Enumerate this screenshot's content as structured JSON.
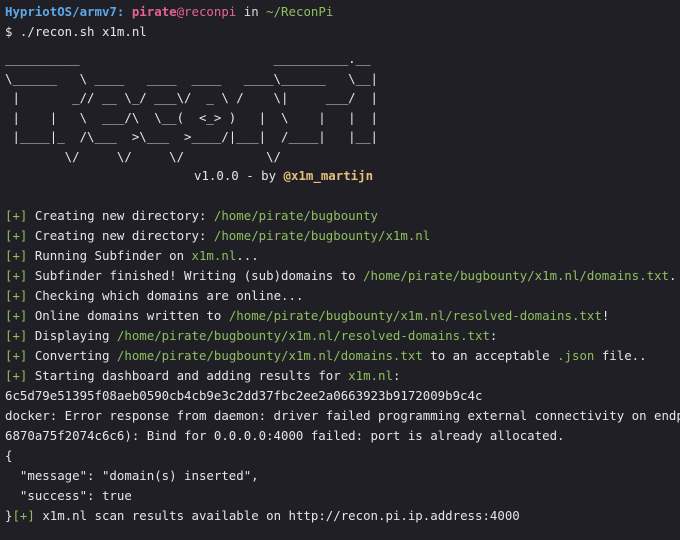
{
  "prompt": {
    "user": "HypriotOS/armv7:",
    "name": "pirate",
    "host": "@reconpi",
    "in": "in",
    "path": "~/ReconPi"
  },
  "command": "$ ./recon.sh x1m.nl",
  "banner": [
    "__________                          __________.__",
    "\\______   \\ ____   ____  ____   ____\\______   \\__|",
    " |       _// __ \\_/ ___\\/  _ \\ /    \\|     ___/  |",
    " |    |   \\  ___/\\  \\__(  <_> )   |  \\    |   |  |",
    " |____|_  /\\___  >\\___  >____/|___|  /____|   |__|",
    "        \\/     \\/     \\/           \\/"
  ],
  "version": "v1.0.0 - by",
  "author": "@x1m_martijn",
  "log": [
    {
      "prefix": "[+]",
      "text": " Creating new directory: ",
      "highlight": "/home/pirate/bugbounty",
      "suffix": ""
    },
    {
      "prefix": "[+]",
      "text": " Creating new directory: ",
      "highlight": "/home/pirate/bugbounty/x1m.nl",
      "suffix": ""
    },
    {
      "prefix": "[+]",
      "text": " Running Subfinder on ",
      "highlight": "x1m.nl",
      "suffix": "..."
    },
    {
      "prefix": "[+]",
      "text": " Subfinder finished! Writing (sub)domains to ",
      "highlight": "/home/pirate/bugbounty/x1m.nl/domains.txt",
      "suffix": "."
    },
    {
      "prefix": "[+]",
      "text": " Checking which domains are online...",
      "highlight": "",
      "suffix": ""
    },
    {
      "prefix": "[+]",
      "text": " Online domains written to ",
      "highlight": "/home/pirate/bugbounty/x1m.nl/resolved-domains.txt",
      "suffix": "!"
    },
    {
      "prefix": "[+]",
      "text": " Displaying ",
      "highlight": "/home/pirate/bugbounty/x1m.nl/resolved-domains.txt",
      "suffix": ":"
    },
    {
      "prefix": "[+]",
      "text": " Converting ",
      "highlight": "/home/pirate/bugbounty/x1m.nl/domains.txt",
      "suffix": " to an acceptable ",
      "highlight2": ".json",
      "suffix2": " file.."
    },
    {
      "prefix": "[+]",
      "text": " Starting dashboard and adding results for ",
      "highlight": "x1m.nl",
      "suffix": ":"
    }
  ],
  "hash_line": "6c5d79e51395f08aeb0590cb4cb9e3c2dd37fbc2ee2a0663923b9172009b9c4c",
  "error_line_1": "docker: Error response from daemon: driver failed programming external connectivity on endpo",
  "error_line_2": "6870a75f2074c6c6): Bind for 0.0.0.0:4000 failed: port is already allocated.",
  "json_open": "{",
  "json_message": "  \"message\": \"domain(s) inserted\",",
  "json_success": "  \"success\": true",
  "final_close": "}",
  "final_prefix": "[+]",
  "final_text": " x1m.nl scan results available on http://recon.pi.ip.address:4000"
}
